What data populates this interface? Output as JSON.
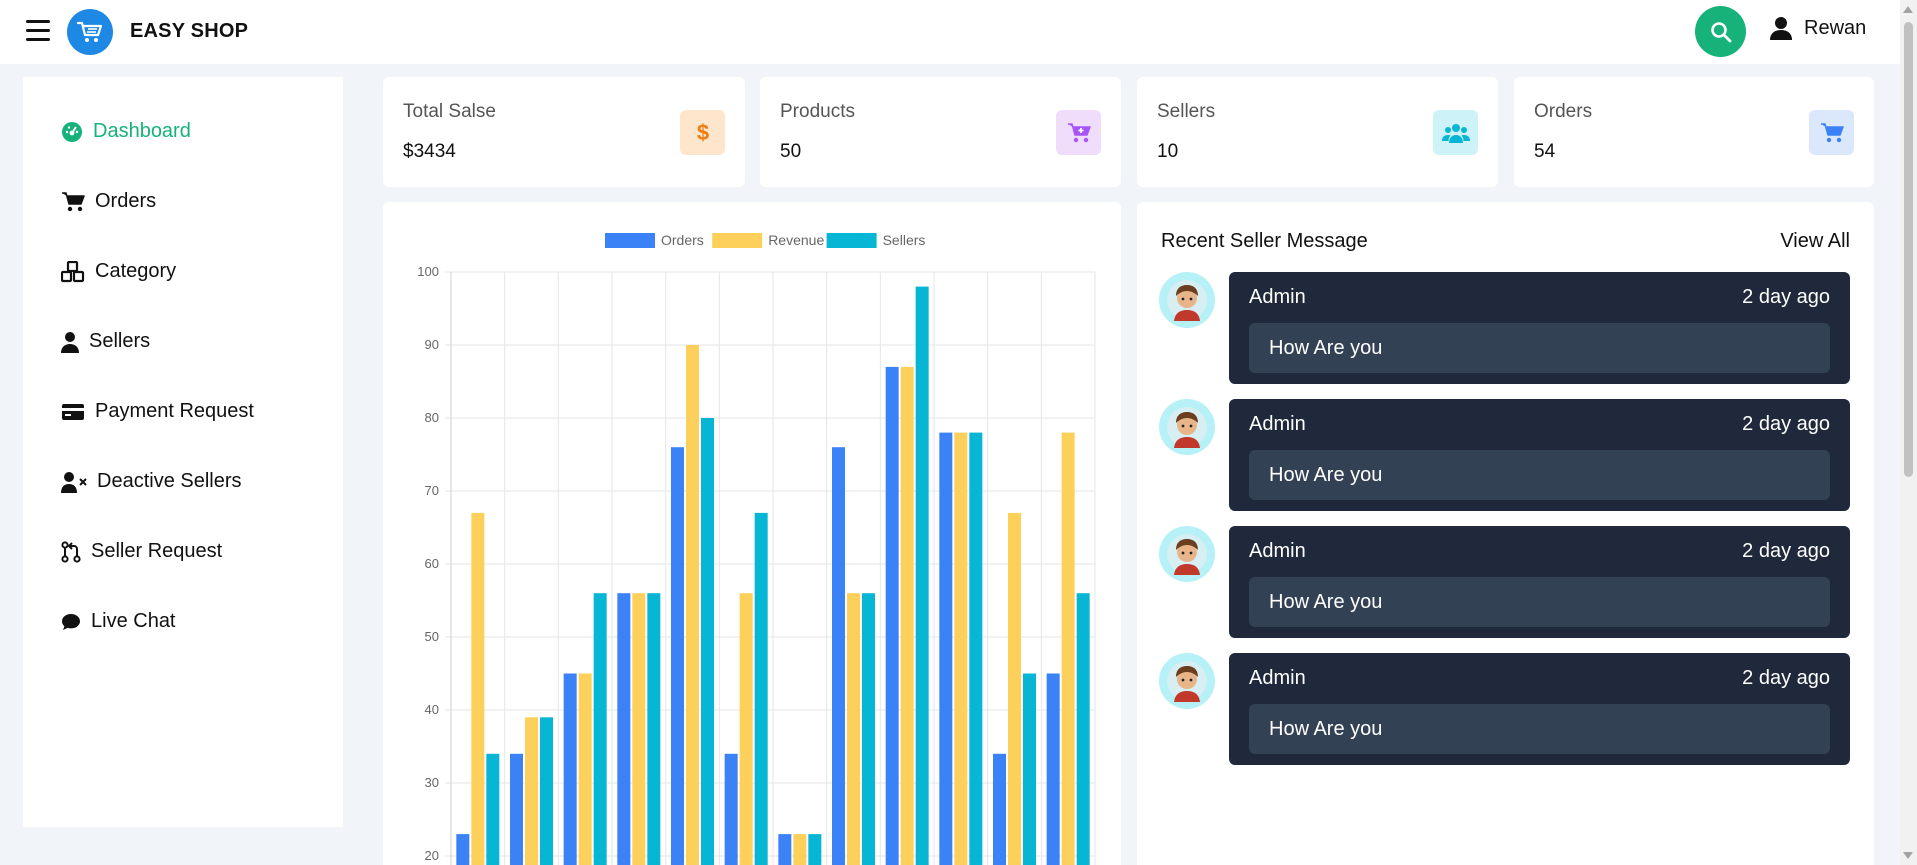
{
  "header": {
    "brand": "EASY SHOP",
    "user_name": "Rewan",
    "colors": {
      "accent": "#16b27a",
      "logo": "#1e88e5"
    }
  },
  "sidebar": {
    "items": [
      {
        "label": "Dashboard",
        "icon": "gauge-icon",
        "active": true
      },
      {
        "label": "Orders",
        "icon": "cart-icon"
      },
      {
        "label": "Category",
        "icon": "cubes-icon"
      },
      {
        "label": "Sellers",
        "icon": "user-icon"
      },
      {
        "label": "Payment Request",
        "icon": "credit-card-icon"
      },
      {
        "label": "Deactive Sellers",
        "icon": "user-x-icon"
      },
      {
        "label": "Seller Request",
        "icon": "git-pull-request-icon"
      },
      {
        "label": "Live Chat",
        "icon": "chat-icon"
      }
    ]
  },
  "stats": [
    {
      "label": "Total Salse",
      "value": "$3434",
      "icon": "dollar-icon",
      "color": "#f59e0b",
      "bg": "#fde6cc"
    },
    {
      "label": "Products",
      "value": "50",
      "icon": "cart-plus-icon",
      "color": "#a855f7",
      "bg": "#f0dcfb"
    },
    {
      "label": "Sellers",
      "value": "10",
      "icon": "users-icon",
      "color": "#06b6d4",
      "bg": "#cdf3f8"
    },
    {
      "label": "Orders",
      "value": "54",
      "icon": "cart-icon",
      "color": "#3b82f6",
      "bg": "#dbe8fc"
    }
  ],
  "chart_data": {
    "type": "bar",
    "categories": [
      "",
      "",
      "",
      "",
      "",
      "",
      "",
      "",
      "",
      "",
      "",
      ""
    ],
    "series": [
      {
        "name": "Orders",
        "color": "#3b82f6",
        "values": [
          23,
          34,
          45,
          56,
          76,
          34,
          23,
          76,
          87,
          78,
          34,
          45
        ]
      },
      {
        "name": "Revenue",
        "color": "#fcd05a",
        "values": [
          67,
          39,
          45,
          56,
          90,
          56,
          23,
          56,
          87,
          78,
          67,
          78
        ]
      },
      {
        "name": "Sellers",
        "color": "#06b6d4",
        "values": [
          34,
          39,
          56,
          56,
          80,
          67,
          23,
          56,
          98,
          78,
          45,
          56
        ]
      }
    ],
    "yticks": [
      "20",
      "30",
      "40",
      "50",
      "60",
      "70",
      "80",
      "90",
      "100"
    ],
    "ylim": [
      0,
      100
    ],
    "legend": "top",
    "grid": true
  },
  "messages": {
    "title": "Recent Seller Message",
    "view_all": "View All",
    "items": [
      {
        "name": "Admin",
        "time": "2 day ago",
        "text": "How Are you"
      },
      {
        "name": "Admin",
        "time": "2 day ago",
        "text": "How Are you"
      },
      {
        "name": "Admin",
        "time": "2 day ago",
        "text": "How Are you"
      },
      {
        "name": "Admin",
        "time": "2 day ago",
        "text": "How Are you"
      }
    ]
  }
}
